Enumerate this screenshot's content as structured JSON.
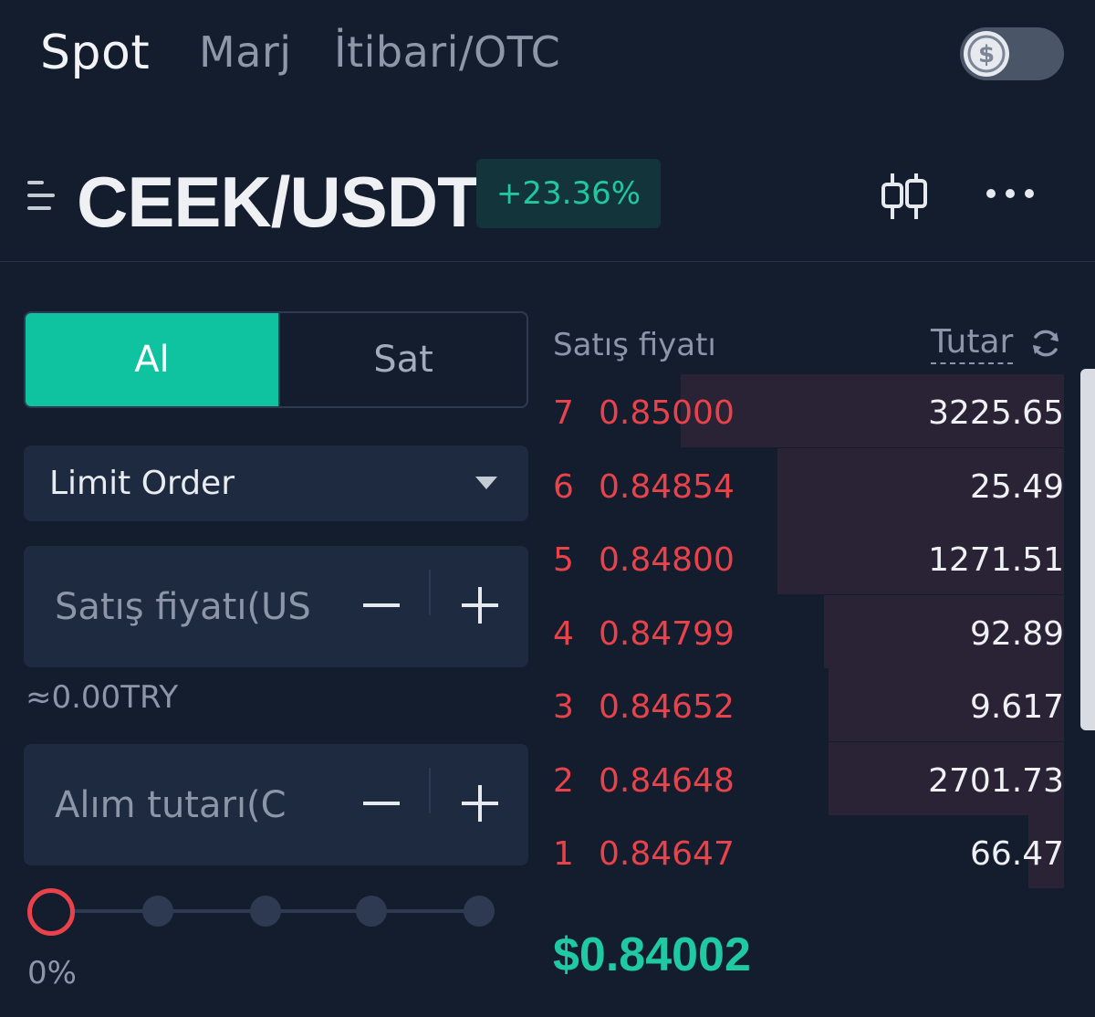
{
  "tabs": [
    "Spot",
    "Marj",
    "İtibari/OTC"
  ],
  "currency_toggle": {
    "symbol": "$"
  },
  "pair": {
    "name": "CEEK/USDT",
    "change": "+23.36%"
  },
  "colors": {
    "accent": "#10c3a0",
    "sell": "#e8424a",
    "background": "#131d2e"
  },
  "trade": {
    "buy_label": "Al",
    "sell_label": "Sat",
    "order_type": "Limit Order",
    "price_placeholder": "Satış fiyatı(US",
    "amount_placeholder": "Alım tutarı(C",
    "approx": "≈0.00TRY",
    "slider_percent": "0%"
  },
  "orderbook": {
    "price_header": "Satış fiyatı",
    "amount_header": "Tutar",
    "rows": [
      {
        "index": "7",
        "price": "0.85000",
        "amount": "3225.65",
        "depth": 0.75
      },
      {
        "index": "6",
        "price": "0.84854",
        "amount": "25.49",
        "depth": 0.56
      },
      {
        "index": "5",
        "price": "0.84800",
        "amount": "1271.51",
        "depth": 0.56
      },
      {
        "index": "4",
        "price": "0.84799",
        "amount": "92.89",
        "depth": 0.47
      },
      {
        "index": "3",
        "price": "0.84652",
        "amount": "9.617",
        "depth": 0.46
      },
      {
        "index": "2",
        "price": "0.84648",
        "amount": "2701.73",
        "depth": 0.46
      },
      {
        "index": "1",
        "price": "0.84647",
        "amount": "66.47",
        "depth": 0.07
      }
    ],
    "last_price": "$0.84002"
  }
}
